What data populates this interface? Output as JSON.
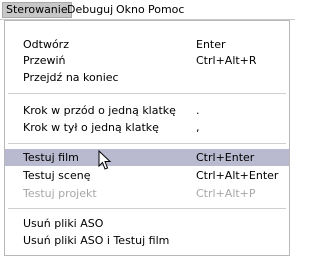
{
  "menubar": {
    "items": [
      "Sterowanie",
      "Debuguj",
      "Okno",
      "Pomoc"
    ]
  },
  "menu": {
    "items": [
      {
        "label": "Odtwórz",
        "shortcut": "Enter"
      },
      {
        "label": "Przewiń",
        "shortcut": "Ctrl+Alt+R"
      },
      {
        "label": "Przejdź na koniec",
        "shortcut": ""
      },
      {
        "label": "Krok w przód o jedną klatkę",
        "shortcut": "."
      },
      {
        "label": "Krok w tył o jedną klatkę",
        "shortcut": ","
      },
      {
        "label": "Testuj film",
        "shortcut": "Ctrl+Enter"
      },
      {
        "label": "Testuj scenę",
        "shortcut": "Ctrl+Alt+Enter"
      },
      {
        "label": "Testuj projekt",
        "shortcut": "Ctrl+Alt+P"
      },
      {
        "label": "Usuń pliki ASO",
        "shortcut": ""
      },
      {
        "label": "Usuń pliki ASO i Testuj film",
        "shortcut": ""
      }
    ]
  },
  "colors": {
    "highlight": "#b9b9cf",
    "disabled_text": "#a7a7a7",
    "active_menu_bg": "#c7c7c7"
  }
}
